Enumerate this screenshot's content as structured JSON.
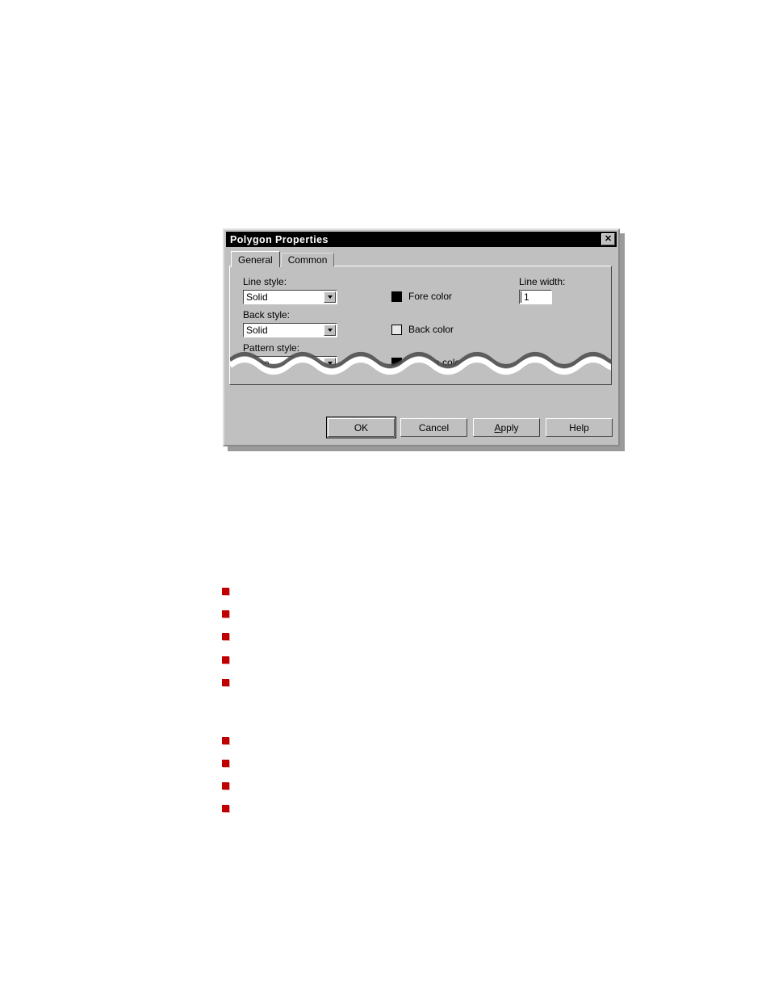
{
  "dialog": {
    "title": "Polygon Properties",
    "close_label": "✕",
    "tabs": [
      {
        "label": "General",
        "active": true
      },
      {
        "label": "Common",
        "active": false
      }
    ],
    "fields": {
      "line_style": {
        "label": "Line style:",
        "value": "Solid"
      },
      "back_style": {
        "label": "Back style:",
        "value": "Solid"
      },
      "pattern_style": {
        "label": "Pattern style:",
        "value": "None"
      },
      "line_width": {
        "label": "Line width:",
        "value": "1"
      }
    },
    "colors": [
      {
        "label": "Fore color",
        "swatch": "#000000"
      },
      {
        "label": "Back color",
        "swatch": "#e8e8e8"
      },
      {
        "label": "Pattern color",
        "swatch": "#000000"
      }
    ],
    "buttons": [
      {
        "label": "OK",
        "mnemonic": "",
        "default": true
      },
      {
        "label": "Cancel",
        "mnemonic": "",
        "default": false
      },
      {
        "label": "Apply",
        "mnemonic": "A",
        "default": false
      },
      {
        "label": "Help",
        "mnemonic": "",
        "default": false
      }
    ]
  },
  "bullets": {
    "color": "#c00000",
    "group_one_count": 5,
    "group_two_count": 4
  }
}
